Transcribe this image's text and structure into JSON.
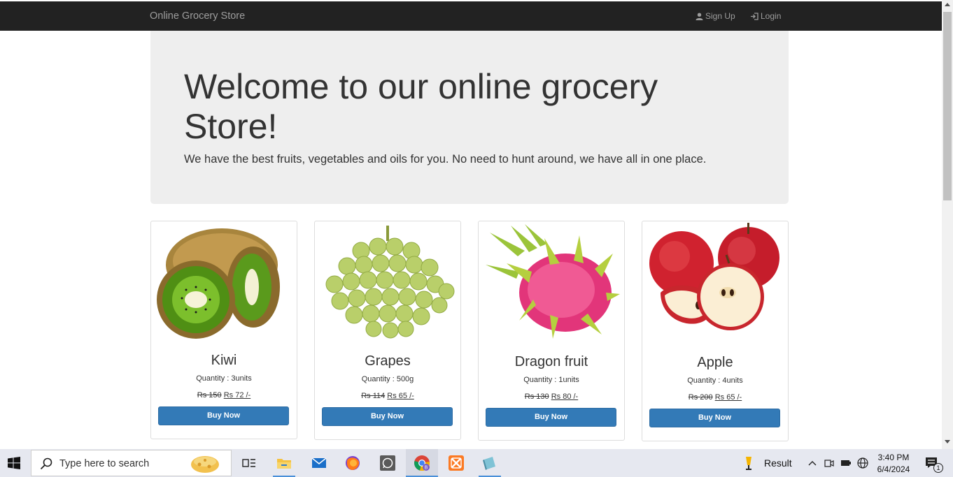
{
  "navbar": {
    "brand": "Online Grocery Store",
    "signup_label": "Sign Up",
    "login_label": "Login"
  },
  "hero": {
    "title": "Welcome to our online grocery Store!",
    "subtitle": "We have the best fruits, vegetables and oils for you. No need to hunt around, we have all in one place."
  },
  "products": [
    {
      "name": "Kiwi",
      "quantity": "Quantity : 3units",
      "old_price": "Rs 150",
      "new_price": "Rs 72 /-",
      "button": "Buy Now",
      "image": "kiwi-image"
    },
    {
      "name": "Grapes",
      "quantity": "Quantity : 500g",
      "old_price": "Rs 114",
      "new_price": "Rs 65 /-",
      "button": "Buy Now",
      "image": "grapes-image"
    },
    {
      "name": "Dragon fruit",
      "quantity": "Quantity : 1units",
      "old_price": "Rs 130",
      "new_price": "Rs 80 /-",
      "button": "Buy Now",
      "image": "dragon-fruit-image"
    },
    {
      "name": "Apple",
      "quantity": "Quantity : 4units",
      "old_price": "Rs 200",
      "new_price": "Rs 65 /-",
      "button": "Buy Now",
      "image": "apple-image"
    }
  ],
  "taskbar": {
    "search_placeholder": "Type here to search",
    "tray_app": "Result",
    "time": "3:40 PM",
    "date": "6/4/2024",
    "notification_count": "1"
  },
  "colors": {
    "navbar": "#222222",
    "jumbotron": "#eeeeee",
    "button": "#337ab7",
    "taskbar": "#e6e8f0"
  }
}
